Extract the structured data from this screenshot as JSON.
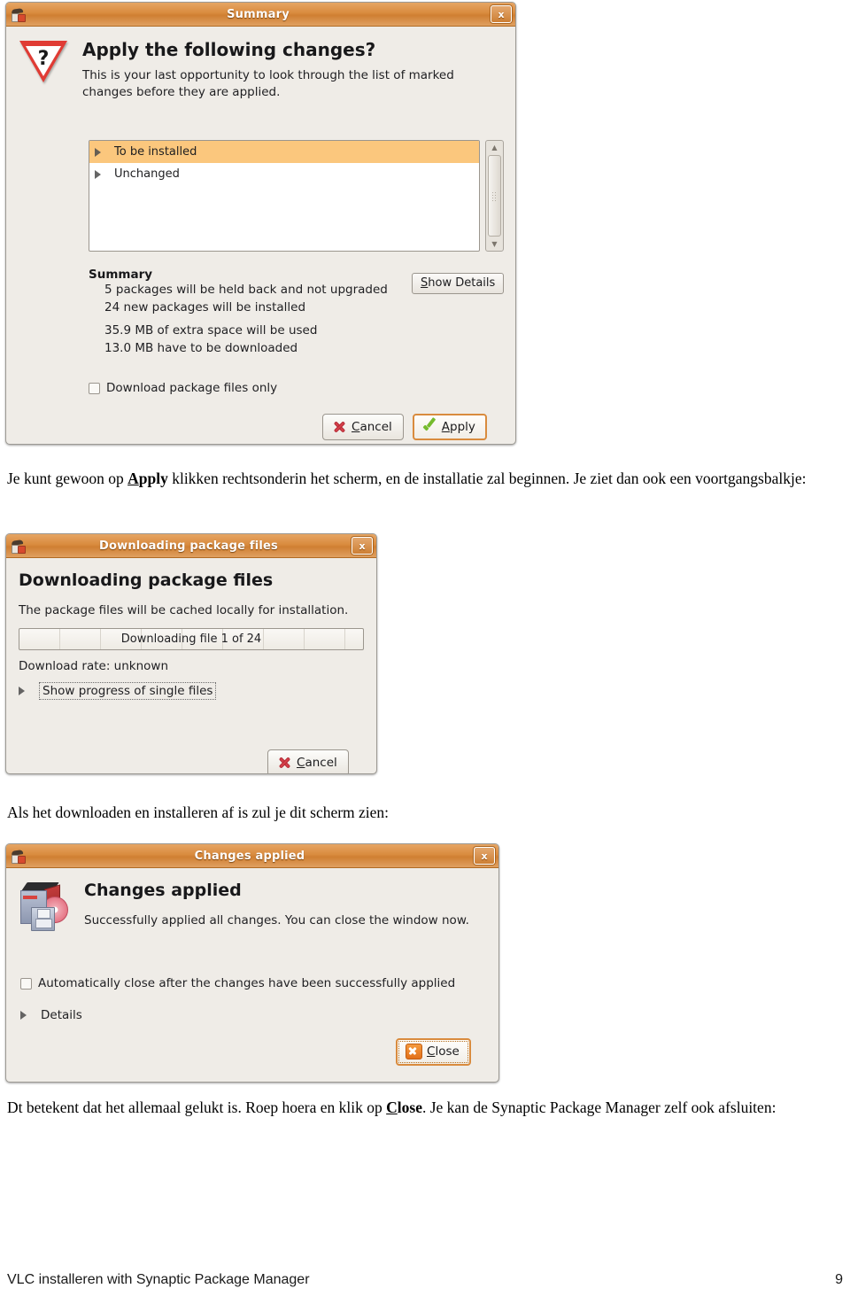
{
  "page": {
    "footer_title": "VLC installeren with Synaptic Package Manager",
    "footer_page_number": "9"
  },
  "paragraph_1": {
    "part_a": "Je kunt gewoon op ",
    "bold_a": "Apply",
    "part_b": " klikken rechtsonderin het scherm, en de installatie zal beginnen. Je ziet dan ook een voortgangsbalkje:"
  },
  "paragraph_2": {
    "text": "Als het downloaden en installeren af is zul je dit scherm zien:"
  },
  "paragraph_3": {
    "part_a": "Dt betekent dat het allemaal gelukt is. Roep hoera en klik op  ",
    "bold_a": "Close",
    "part_b": ". Je kan de Synaptic Package Manager zelf ook afsluiten:"
  },
  "dialog_summary": {
    "window_icon": "synaptic-icon",
    "title": "Summary",
    "close_label": "x",
    "alert_icon": "question-triangle-icon",
    "heading": "Apply the following changes?",
    "description": "This is your last opportunity to look through the list of marked changes before they are applied.",
    "list_items": [
      {
        "label": "To be installed",
        "selected": true
      },
      {
        "label": "Unchanged",
        "selected": false
      }
    ],
    "summary_title": "Summary",
    "summary_lines": [
      "5 packages will be held back and not upgraded",
      "24 new packages will be installed",
      "35.9 MB of extra space will be used",
      "13.0 MB have to be downloaded"
    ],
    "show_details_label": "Show Details",
    "show_details_mnemonic": "S",
    "checkbox_label": "Download package files only",
    "checkbox_checked": false,
    "cancel_label": "Cancel",
    "cancel_mnemonic": "C",
    "apply_label": "Apply",
    "apply_mnemonic": "A",
    "accent_color": "#d98b3e",
    "selection_color": "#fbc77d"
  },
  "dialog_download": {
    "window_icon": "synaptic-icon",
    "title": "Downloading package files",
    "close_label": "x",
    "heading": "Downloading package files",
    "description": "The package files will be cached locally for installation.",
    "progress_text": "Downloading file 1 of 24",
    "progress_percent": 0,
    "rate_text": "Download rate: unknown",
    "disclosure_label": "Show progress of single files",
    "cancel_label": "Cancel",
    "cancel_mnemonic": "C"
  },
  "dialog_applied": {
    "window_icon": "synaptic-icon",
    "title": "Changes applied",
    "close_label": "x",
    "status_icon": "package-cd-floppy-icon",
    "heading": "Changes applied",
    "description": "Successfully applied all changes. You can close the window now.",
    "checkbox_label": "Automatically close after the changes have been successfully applied",
    "checkbox_checked": false,
    "disclosure_label": "Details",
    "close_button_label": "Close",
    "close_button_mnemonic": "C"
  }
}
